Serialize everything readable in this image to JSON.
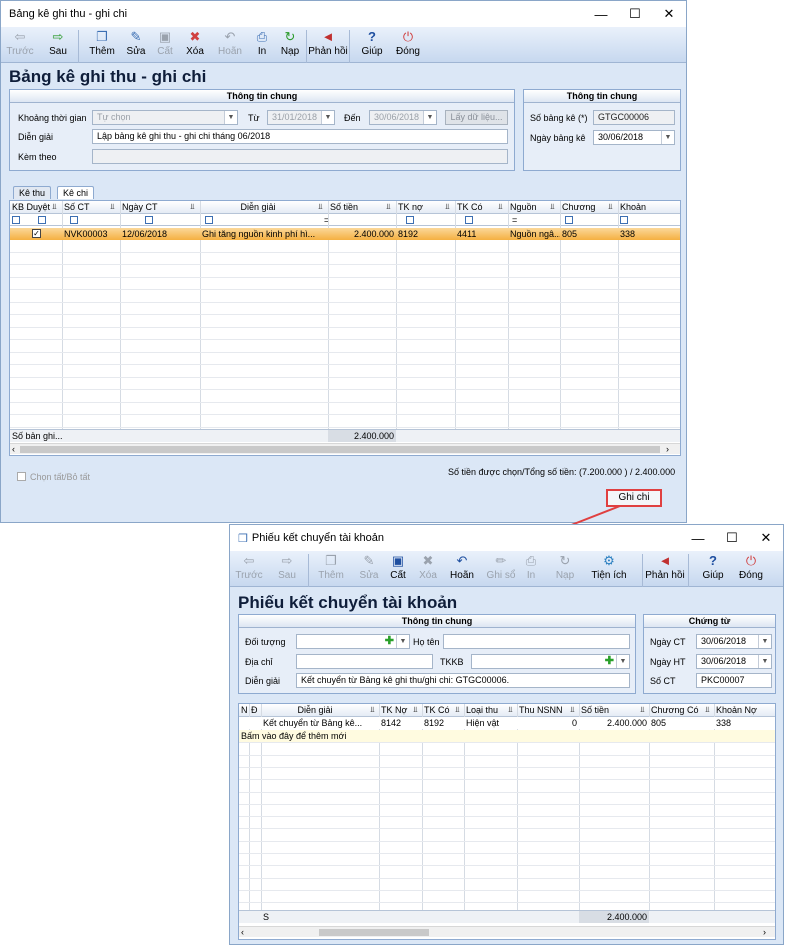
{
  "win1": {
    "title": "Bảng kê ghi thu - ghi chi",
    "toolbar": [
      {
        "icon": "arrow-left-icon",
        "label": "Trước",
        "disabled": true
      },
      {
        "icon": "arrow-right-icon",
        "label": "Sau",
        "disabled": false
      },
      {
        "icon": "add-icon",
        "label": "Thêm",
        "disabled": false
      },
      {
        "icon": "edit-icon",
        "label": "Sửa",
        "disabled": false
      },
      {
        "icon": "save-icon",
        "label": "Cất",
        "disabled": true
      },
      {
        "icon": "delete-icon",
        "label": "Xóa",
        "disabled": false
      },
      {
        "icon": "undo-icon",
        "label": "Hoãn",
        "disabled": true
      },
      {
        "icon": "print-icon",
        "label": "In",
        "disabled": false
      },
      {
        "icon": "refresh-icon",
        "label": "Nạp",
        "disabled": false
      },
      {
        "icon": "megaphone-icon",
        "label": "Phản hồi",
        "disabled": false
      },
      {
        "icon": "help-icon",
        "label": "Giúp",
        "disabled": false
      },
      {
        "icon": "close-icon",
        "label": "Đóng",
        "disabled": false
      }
    ],
    "heading": "Bảng kê ghi thu - ghi chi",
    "general": {
      "title": "Thông tin chung",
      "period_label": "Khoảng thời gian",
      "period_value": "Tự chọn",
      "from_label": "Từ",
      "from_value": "31/01/2018",
      "to_label": "Đến",
      "to_value": "30/06/2018",
      "fetch_button": "Lấy dữ liệu...",
      "desc_label": "Diễn giải",
      "desc_value": "Lập bảng kê ghi thu - ghi chi tháng 06/2018",
      "attach_label": "Kèm theo",
      "attach_value": ""
    },
    "voucher": {
      "title": "Thông tin chung",
      "no_label": "Số bảng kê (*)",
      "no_value": "GTGC00006",
      "date_label": "Ngày bảng kê",
      "date_value": "30/06/2018"
    },
    "tabs": [
      "Kê thu",
      "Kê chi"
    ],
    "columns": [
      "KB Duyệt",
      "Số CT",
      "Ngày CT",
      "Diễn giải",
      "Số tiền",
      "TK nợ",
      "TK Có",
      "Nguồn",
      "Chương",
      "Khoản"
    ],
    "rows": [
      {
        "approved": true,
        "so_ct": "NVK00003",
        "ngay_ct": "12/06/2018",
        "dien_giai": "Ghi tăng nguồn kinh phí hì...",
        "so_tien": "2.400.000",
        "tk_no": "8192",
        "tk_co": "4411",
        "nguon": "Nguồn ngâ...",
        "chuong": "805",
        "khoan": "338"
      }
    ],
    "footer_label": "Số bản ghi...",
    "footer_total": "2.400.000",
    "select_all_label": "Chọn tất/Bỏ tất",
    "summary": "Số tiền được chọn/Tổng số tiền: (7.200.000 ) / 2.400.000",
    "ghichi_button": "Ghi chi"
  },
  "win2": {
    "title": "Phiếu kết chuyển tài khoản",
    "toolbar": [
      {
        "icon": "arrow-left-icon",
        "label": "Trước",
        "disabled": true
      },
      {
        "icon": "arrow-right-icon",
        "label": "Sau",
        "disabled": true
      },
      {
        "icon": "add-icon",
        "label": "Thêm",
        "disabled": true
      },
      {
        "icon": "edit-icon",
        "label": "Sửa",
        "disabled": true
      },
      {
        "icon": "save-icon",
        "label": "Cất",
        "disabled": false
      },
      {
        "icon": "delete-icon",
        "label": "Xóa",
        "disabled": true
      },
      {
        "icon": "undo-icon",
        "label": "Hoãn",
        "disabled": false
      },
      {
        "icon": "pencil-icon",
        "label": "Ghi sổ",
        "disabled": true
      },
      {
        "icon": "print-icon",
        "label": "In",
        "disabled": true
      },
      {
        "icon": "refresh-icon",
        "label": "Nạp",
        "disabled": true
      },
      {
        "icon": "tools-icon",
        "label": "Tiện ích",
        "disabled": false
      },
      {
        "icon": "megaphone-icon",
        "label": "Phản hồi",
        "disabled": false
      },
      {
        "icon": "help-icon",
        "label": "Giúp",
        "disabled": false
      },
      {
        "icon": "close-icon",
        "label": "Đóng",
        "disabled": false
      }
    ],
    "heading": "Phiếu kết chuyển tài khoản",
    "general": {
      "title": "Thông tin chung",
      "object_label": "Đối tượng",
      "object_value": "",
      "name_label": "Họ tên",
      "name_value": "",
      "address_label": "Địa chỉ",
      "address_value": "",
      "tkkb_label": "TKKB",
      "tkkb_value": "",
      "desc_label": "Diễn giải",
      "desc_value": "Kết chuyển từ Bảng kê ghi thu/ghi chi: GTGC00006."
    },
    "voucher": {
      "title": "Chứng từ",
      "date_ct_label": "Ngày CT",
      "date_ct_value": "30/06/2018",
      "date_ht_label": "Ngày HT",
      "date_ht_value": "30/06/2018",
      "no_label": "Số CT",
      "no_value": "PKC00007"
    },
    "columns": [
      "N",
      "Đ",
      "Diễn giải",
      "TK Nợ",
      "TK Có",
      "Loại thu",
      "Thu NSNN",
      "Số tiền",
      "Chương Có",
      "Khoản Nợ"
    ],
    "rows": [
      {
        "dien_giai": "Kết chuyển từ Bảng kê...",
        "tk_no": "8142",
        "tk_co": "8192",
        "loai_thu": "Hiện vật",
        "thu_nsnn": "0",
        "so_tien": "2.400.000",
        "chuong_co": "805",
        "khoan_no": "338"
      }
    ],
    "add_row_hint": "Bấm vào đây để thêm mới",
    "footer_marker": "S",
    "footer_total": "2.400.000"
  }
}
